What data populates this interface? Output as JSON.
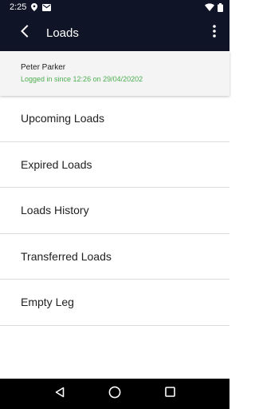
{
  "status_bar": {
    "time": "2:25",
    "icons": [
      "location-icon",
      "mail-icon",
      "wifi-icon",
      "battery-icon"
    ]
  },
  "app_bar": {
    "title": "Loads",
    "back_icon": "arrow-back-icon",
    "menu_icon": "more-vert-icon"
  },
  "user": {
    "name": "Peter Parker",
    "status": "Logged in since 12:26 on 29/04/20202"
  },
  "menu": {
    "items": [
      {
        "label": "Upcoming Loads"
      },
      {
        "label": "Expired Loads"
      },
      {
        "label": "Loads History"
      },
      {
        "label": "Transferred Loads"
      },
      {
        "label": "Empty Leg"
      }
    ]
  },
  "nav_bar": {
    "icons": [
      "back-triangle-icon",
      "home-circle-icon",
      "recents-square-icon"
    ]
  },
  "colors": {
    "app_bar": "#0f1426",
    "status_green": "#4caf50",
    "divider": "#dcdcdc",
    "card_bg": "#f4f4f4",
    "nav_bar": "#000000"
  }
}
